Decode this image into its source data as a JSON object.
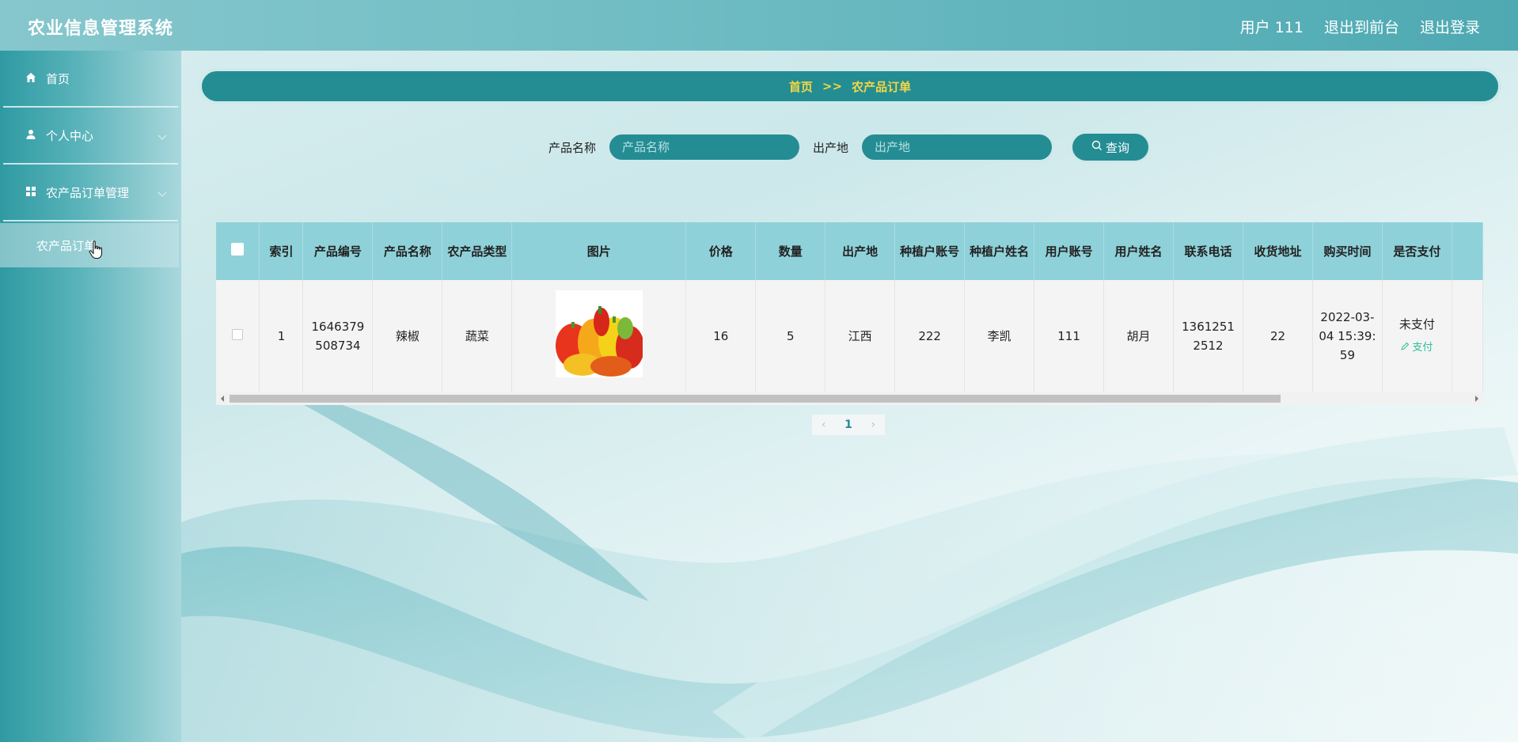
{
  "app": {
    "title": "农业信息管理系统"
  },
  "header": {
    "user_label": "用户 111",
    "to_front_label": "退出到前台",
    "logout_label": "退出登录"
  },
  "sidebar": {
    "items": [
      {
        "label": "首页",
        "icon": "home-icon",
        "expandable": false
      },
      {
        "label": "个人中心",
        "icon": "user-icon",
        "expandable": true
      },
      {
        "label": "农产品订单管理",
        "icon": "grid-icon",
        "expandable": true
      }
    ],
    "active_sub": {
      "label": "农产品订单"
    }
  },
  "breadcrumb": {
    "home": "首页",
    "separator": ">>",
    "current": "农产品订单"
  },
  "search": {
    "product_name_label": "产品名称",
    "product_name_placeholder": "产品名称",
    "origin_label": "出产地",
    "origin_placeholder": "出产地",
    "query_label": "查询"
  },
  "table": {
    "headers": [
      "",
      "索引",
      "产品编号",
      "产品名称",
      "农产品类型",
      "图片",
      "价格",
      "数量",
      "出产地",
      "种植户账号",
      "种植户姓名",
      "用户账号",
      "用户姓名",
      "联系电话",
      "收货地址",
      "购买时间",
      "是否支付",
      ""
    ],
    "rows": [
      {
        "index": "1",
        "product_no": "1646379508734",
        "product_name": "辣椒",
        "category": "蔬菜",
        "image": "bell-peppers-photo",
        "price": "16",
        "quantity": "5",
        "origin": "江西",
        "grower_account": "222",
        "grower_name": "李凯",
        "user_account": "111",
        "user_name": "胡月",
        "phone": "13612512512",
        "address": "22",
        "purchase_time": "2022-03-04 15:39:59",
        "paid_status": "未支付",
        "pay_action": "支付"
      }
    ]
  },
  "pagination": {
    "current": "1"
  },
  "colors": {
    "accent": "#248d93",
    "breadcrumb_text": "#f5d742",
    "header_row": "#8fd1d9",
    "pay_link": "#2abf9a"
  }
}
